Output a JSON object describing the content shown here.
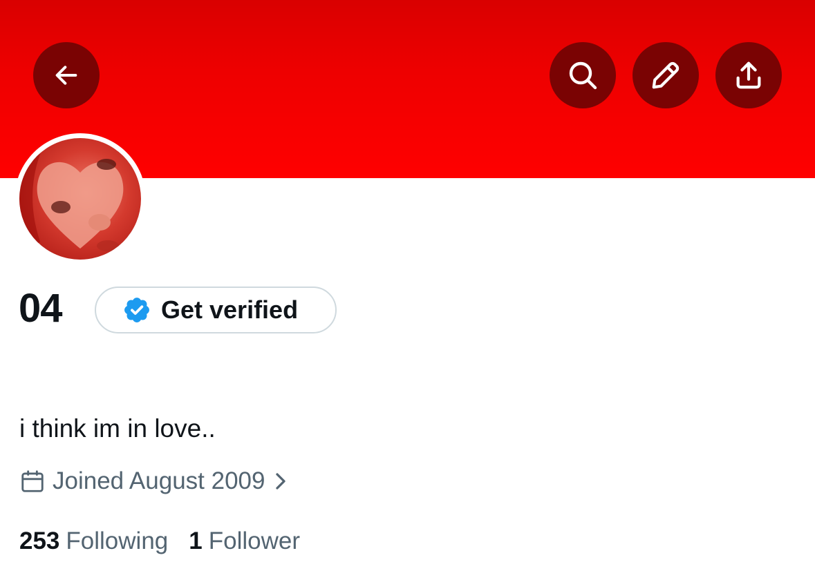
{
  "profile": {
    "display_name": "04",
    "verify_label": "Get verified",
    "bio": "i think im in love..",
    "joined": "Joined August 2009",
    "following_count": "253",
    "following_label": "Following",
    "followers_count": "1",
    "followers_label": "Follower"
  },
  "header": {
    "buttons": [
      "back",
      "search",
      "edit",
      "share"
    ]
  },
  "colors": {
    "banner": "#ff0000",
    "icon_button_bg": "#7a0303",
    "verified_badge": "#1d9bf0",
    "secondary_text": "#536471",
    "primary_text": "#0f1419"
  },
  "icons": {
    "back": "arrow-left-icon",
    "search": "search-icon",
    "edit": "pencil-icon",
    "share": "share-icon",
    "badge": "verified-badge-icon",
    "calendar": "calendar-icon",
    "chevron": "chevron-right-icon"
  }
}
